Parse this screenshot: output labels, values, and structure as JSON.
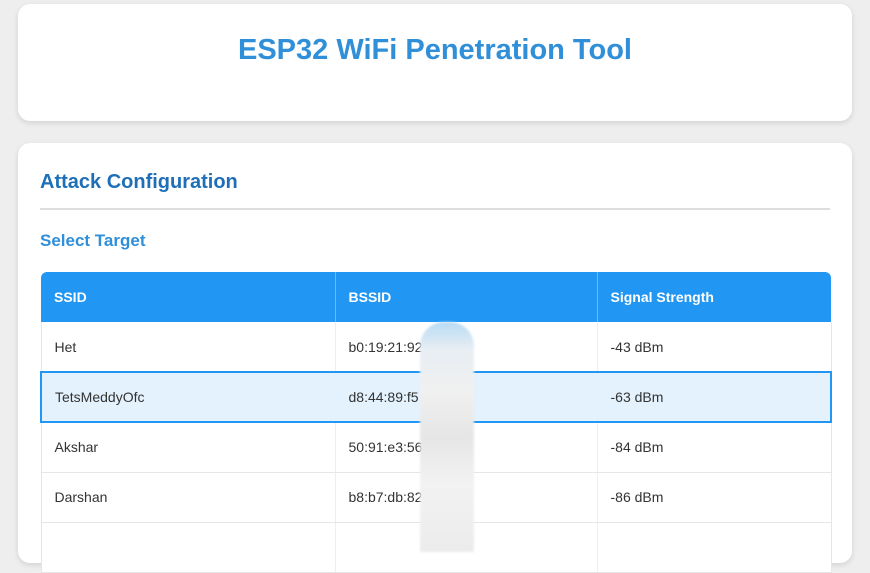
{
  "header": {
    "title": "ESP32 WiFi Penetration Tool"
  },
  "config": {
    "section_title": "Attack Configuration",
    "subsection_title": "Select Target"
  },
  "table": {
    "columns": [
      "SSID",
      "BSSID",
      "Signal Strength"
    ],
    "rows": [
      {
        "ssid": "Het",
        "bssid": "b0:19:21:92",
        "signal": "-43 dBm"
      },
      {
        "ssid": "TetsMeddyOfc",
        "bssid": "d8:44:89:f5",
        "signal": "-63 dBm"
      },
      {
        "ssid": "Akshar",
        "bssid": "50:91:e3:56",
        "signal": "-84 dBm"
      },
      {
        "ssid": "Darshan",
        "bssid": "b8:b7:db:82",
        "signal": "-86 dBm"
      }
    ],
    "selected_row": 1
  },
  "colors": {
    "accent": "#2196f3",
    "title": "#2f8fd8",
    "section_title": "#1f6fb8",
    "selected_row_bg": "#e3f2fd"
  }
}
